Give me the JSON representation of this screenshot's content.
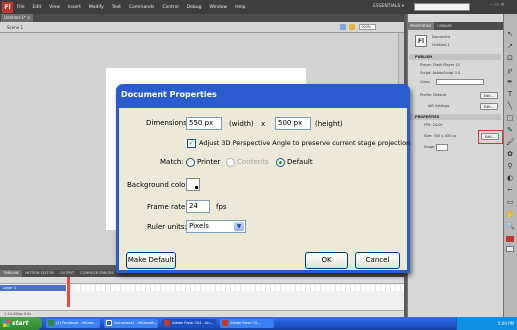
{
  "menubar": {
    "logo": "Fl",
    "items": [
      "File",
      "Edit",
      "View",
      "Insert",
      "Modify",
      "Text",
      "Commands",
      "Control",
      "Debug",
      "Window",
      "Help"
    ],
    "workspace": "ESSENTIALS ▾",
    "window_controls": "– ▭ ✕"
  },
  "document": {
    "tab": "Untitled-1* ✕",
    "scene": "Scene 1",
    "zoom": "100%"
  },
  "dialog": {
    "title": "Document Properties",
    "dimensions_label": "Dimensions:",
    "width_value": "550 px",
    "width_label": "(width)",
    "x_sep": "x",
    "height_value": "500 px",
    "height_label": "(height)",
    "adjust3d_label": "Adjust 3D Perspective Angle to preserve current stage projection",
    "match_label": "Match:",
    "match_options": [
      "Printer",
      "Contents",
      "Default"
    ],
    "bg_label": "Background color:",
    "framerate_label": "Frame rate:",
    "framerate_value": "24",
    "fps_label": "fps",
    "ruler_label": "Ruler units:",
    "ruler_value": "Pixels",
    "make_default": "Make Default",
    "ok": "OK",
    "cancel": "Cancel"
  },
  "timeline": {
    "tabs": [
      "TIMELINE",
      "MOTION EDITOR",
      "OUTPUT",
      "COMPILER ERRORS"
    ],
    "layer": "Layer 1",
    "footer": "1   24.00fps   0.0s"
  },
  "properties": {
    "tabs": [
      "PROPERTIES",
      "LIBRARY"
    ],
    "doc_icon": "Fl",
    "doc_type": "Document",
    "doc_name": "Untitled-1",
    "publish_section": "PUBLISH",
    "player": "Player: Flash Player 10",
    "script": "Script: ActionScript 3.0",
    "class_label": "Class:",
    "profile": "Profile: Default",
    "edit_button": "Edit...",
    "air_settings": "AIR Settings",
    "props_section": "PROPERTIES",
    "fps": "FPS: 24.00",
    "size": "Size: 550 x 400 px",
    "stage_label": "Stage:"
  },
  "taskbar": {
    "start": "start",
    "items": [
      {
        "label": "(2) Facebook - Micros...",
        "color": "#2b8a3e"
      },
      {
        "label": "Document1 - Microsoft...",
        "color": "#2a5ccf"
      },
      {
        "label": "Adobe Flash CS4 - Un...",
        "color": "#c0392b"
      },
      {
        "label": "Adobe Flash CS...",
        "color": "#c0392b"
      }
    ],
    "clock": "5:00 PM"
  }
}
